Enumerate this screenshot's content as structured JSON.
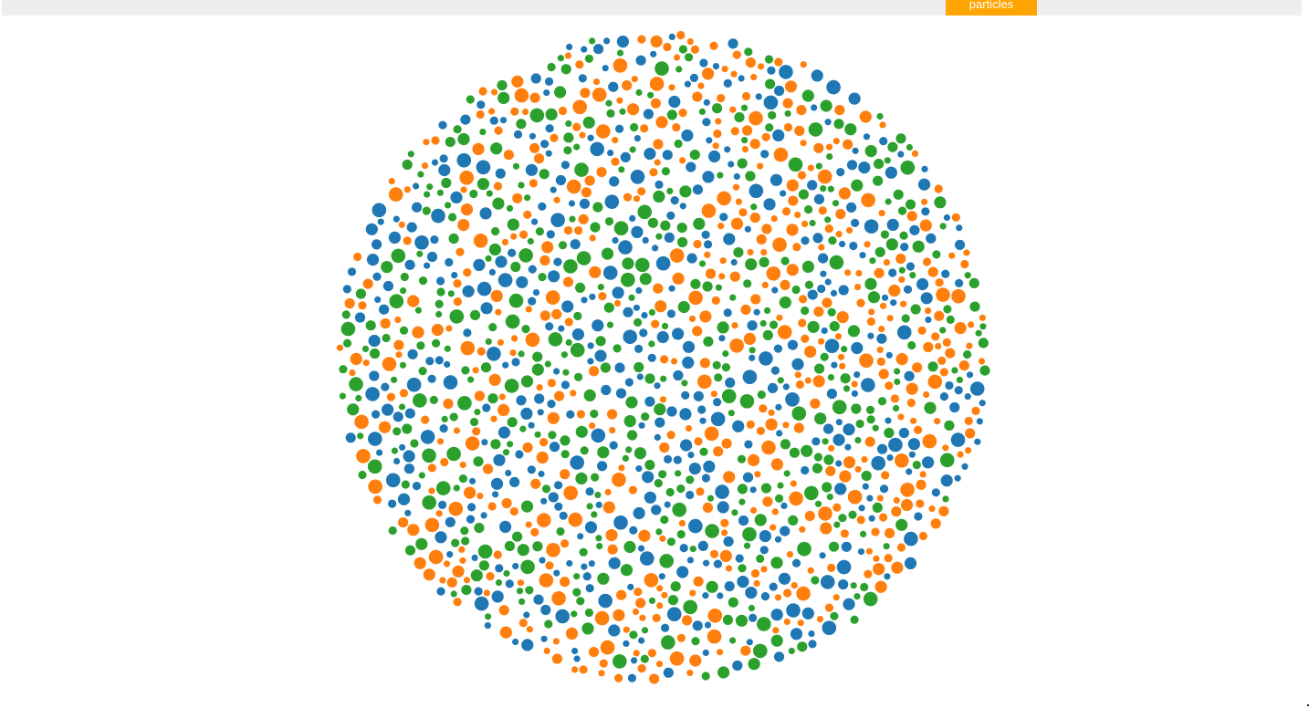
{
  "nav": {
    "active_tab": "particles"
  },
  "visualization": {
    "shape": "circle-packed particles",
    "palette": {
      "blue": "#1f77b4",
      "orange": "#ff7f0e",
      "green": "#2ca02c"
    }
  }
}
